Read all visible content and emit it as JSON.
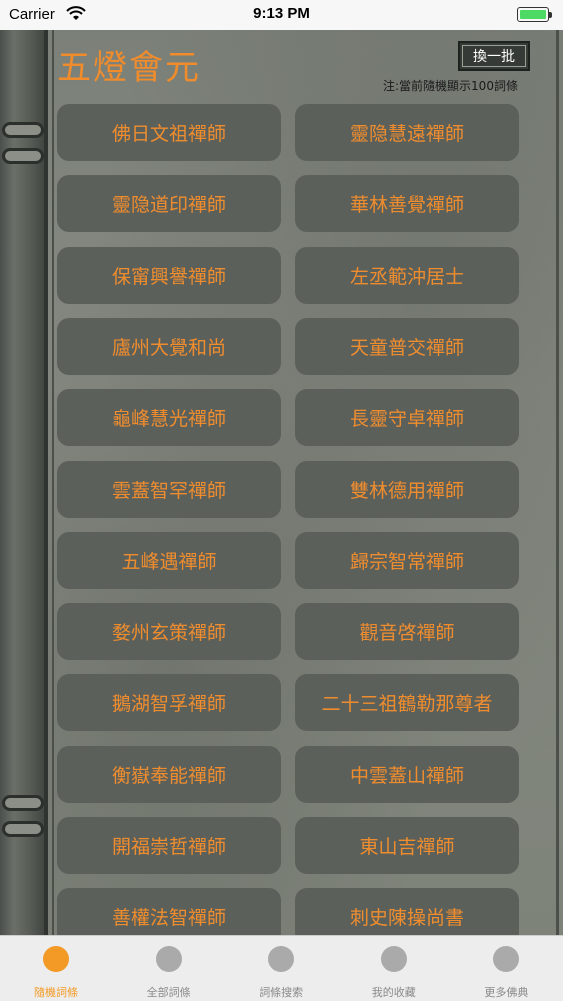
{
  "status_bar": {
    "carrier": "Carrier",
    "time": "9:13 PM"
  },
  "header": {
    "title": "五燈會元",
    "refresh_label": "換一批",
    "note": "注:當前隨機顯示100詞條"
  },
  "items": [
    "佛日文祖禪師",
    "靈隐慧遠禪師",
    "靈隐道印禪師",
    "華林善覺禪師",
    "保甯興譽禪師",
    "左丞範沖居士",
    "廬州大覺和尚",
    "天童普交禪師",
    "龜峰慧光禪師",
    "長靈守卓禪師",
    "雲蓋智罕禪師",
    "雙林德用禪師",
    "五峰遇禪師",
    "歸宗智常禪師",
    "婺州玄策禪師",
    "觀音啓禪師",
    "鵝湖智孚禪師",
    "二十三祖鶴勒那尊者",
    "衡嶽奉能禪師",
    "中雲蓋山禪師",
    "開福崇哲禪師",
    "東山吉禪師",
    "善權法智禪師",
    "刺史陳操尚書"
  ],
  "tabs": [
    {
      "label": "隨機詞條",
      "active": true
    },
    {
      "label": "全部詞條",
      "active": false
    },
    {
      "label": "詞條搜索",
      "active": false
    },
    {
      "label": "我的收藏",
      "active": false
    },
    {
      "label": "更多佛典",
      "active": false
    }
  ],
  "colors": {
    "accent": "#f08c2c",
    "button_bg": "#5c605b",
    "tab_active": "#f39a26"
  }
}
